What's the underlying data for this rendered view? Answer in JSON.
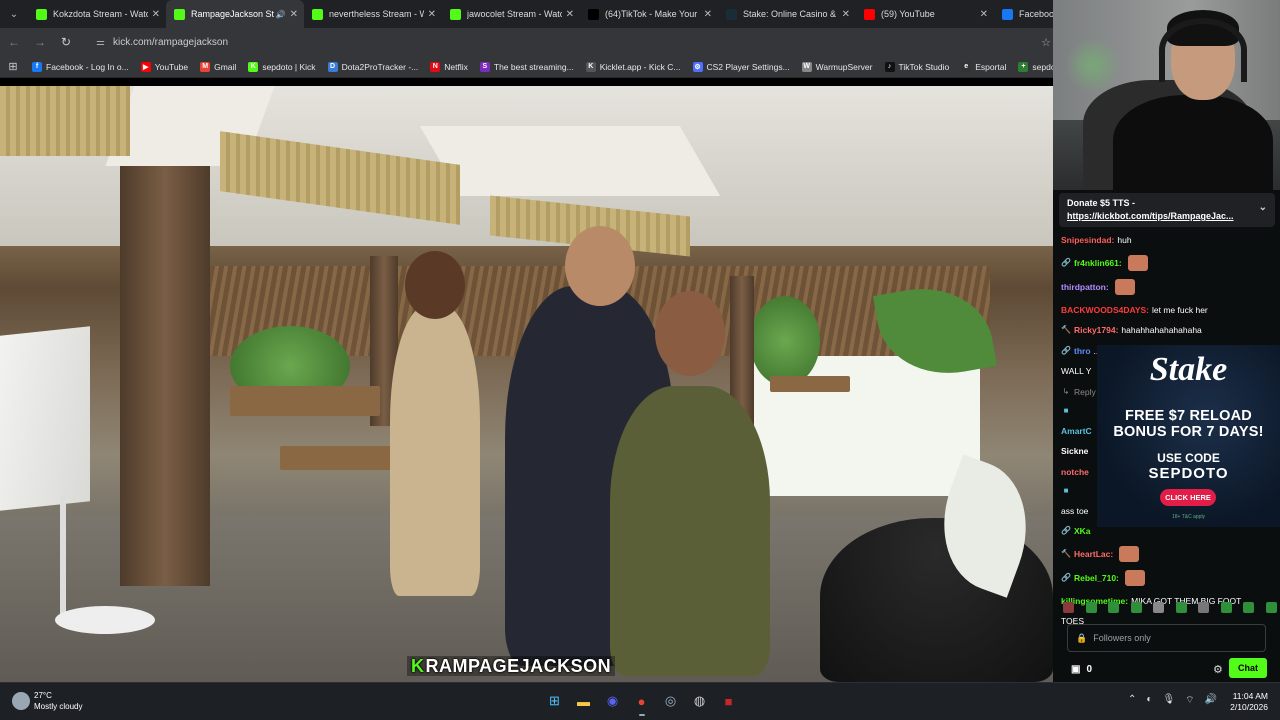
{
  "browser": {
    "tabs": [
      {
        "title": "Kokzdota Stream - Watch",
        "favicon": "kick",
        "color": "#53fc18",
        "active": false
      },
      {
        "title": "RampageJackson Stre",
        "favicon": "kick",
        "color": "#53fc18",
        "active": true
      },
      {
        "title": "nevertheless Stream - Wa",
        "favicon": "kick",
        "color": "#53fc18",
        "active": false
      },
      {
        "title": "jawocolet Stream - Watch",
        "favicon": "kick",
        "color": "#53fc18",
        "active": false
      },
      {
        "title": "(64)TikTok - Make Your D",
        "favicon": "tiktok",
        "color": "#000000",
        "active": false
      },
      {
        "title": "Stake: Online Casino & Sp",
        "favicon": "stake",
        "color": "#1a2c38",
        "active": false
      },
      {
        "title": "(59) YouTube",
        "favicon": "youtube",
        "color": "#ff0000",
        "active": false
      },
      {
        "title": "Facebook",
        "favicon": "facebook",
        "color": "#1877f2",
        "active": false
      }
    ],
    "url": "kick.com/rampagejackson",
    "bookmarks": [
      {
        "label": "Facebook - Log In o...",
        "color": "#1877f2",
        "glyph": "f"
      },
      {
        "label": "YouTube",
        "color": "#ff0000",
        "glyph": "▶"
      },
      {
        "label": "Gmail",
        "color": "#ea4335",
        "glyph": "M"
      },
      {
        "label": "sepdoto | Kick",
        "color": "#53fc18",
        "glyph": "K"
      },
      {
        "label": "Dota2ProTracker -...",
        "color": "#3a7bd5",
        "glyph": "D"
      },
      {
        "label": "Netflix",
        "color": "#e50914",
        "glyph": "N"
      },
      {
        "label": "The best streaming...",
        "color": "#7b2cbf",
        "glyph": "S"
      },
      {
        "label": "Kicklet.app - Kick C...",
        "color": "#555555",
        "glyph": "K"
      },
      {
        "label": "CS2 Player Settings...",
        "color": "#4c6fff",
        "glyph": "⚙"
      },
      {
        "label": "WarmupServer",
        "color": "#888888",
        "glyph": "W"
      },
      {
        "label": "TikTok Studio",
        "color": "#111111",
        "glyph": "♪"
      },
      {
        "label": "Esportal",
        "color": "#333333",
        "glyph": "e"
      },
      {
        "label": "sepdotes | Weig",
        "color": "#2e7d32",
        "glyph": "+"
      }
    ]
  },
  "stream": {
    "watermark_prefix": "K",
    "watermark_text": "RAMPAGEJACKSON"
  },
  "chat": {
    "pinned_title": "Donate $5 TTS -",
    "pinned_link": "https://kickbot.com/tips/RampageJac...",
    "messages": [
      {
        "user": "Snipesindad:",
        "color": "#ff5c5c",
        "text": "huh",
        "badge": "",
        "emote": false
      },
      {
        "user": "fr4nklin661:",
        "color": "#53fc18",
        "text": "",
        "badge": "🔗",
        "emote": true
      },
      {
        "user": "thirdpatton:",
        "color": "#b48cff",
        "text": "",
        "badge": "",
        "emote": true
      },
      {
        "user": "BACKWOODS4DAYS:",
        "color": "#ff3b3b",
        "text": "let me fuck her",
        "badge": "",
        "emote": false
      },
      {
        "user": "Ricky1794:",
        "color": "#ff6a6a",
        "text": "hahahhahahahahaha",
        "badge": "🔨",
        "emote": false
      },
      {
        "user": "thro",
        "color": "#5b8cff",
        "text": "... PUT YOUR HANDS THE",
        "badge": "🔗",
        "emote": false
      },
      {
        "user": "",
        "color": "#ffffff",
        "text": "WALL Y",
        "badge": "",
        "emote": false
      },
      {
        "user": "",
        "color": "#888888",
        "text": "Reply",
        "badge": "↳",
        "emote": false
      },
      {
        "user": "",
        "color": "#5bc0de",
        "text": "",
        "badge": "■",
        "emote": false
      },
      {
        "user": "AmartC",
        "color": "#5bc0de",
        "text": "",
        "badge": "",
        "emote": false
      },
      {
        "user": "Sickne",
        "color": "#ffffff",
        "text": "",
        "badge": "",
        "emote": false
      },
      {
        "user": "notche",
        "color": "#ff6a6a",
        "text": "",
        "badge": "",
        "emote": false
      },
      {
        "user": "",
        "color": "#5bc0de",
        "text": "",
        "badge": "■",
        "emote": false
      },
      {
        "user": "",
        "color": "#ffffff",
        "text": "ass toe",
        "badge": "",
        "emote": false
      },
      {
        "user": "XKa",
        "color": "#53fc18",
        "text": "",
        "badge": "🔗",
        "emote": false
      },
      {
        "user": "HeartLac:",
        "color": "#ff6a6a",
        "text": "",
        "badge": "🔨",
        "emote": true
      },
      {
        "user": "Rebel_710:",
        "color": "#53fc18",
        "text": "",
        "badge": "🔗",
        "emote": true
      },
      {
        "user": "killingsometime:",
        "color": "#53fc18",
        "text": "MIKA GOT THEM BIG FOOT",
        "badge": "",
        "emote": false
      },
      {
        "user": "",
        "color": "#ffffff",
        "text": "TOES",
        "badge": "",
        "emote": false
      }
    ],
    "input_placeholder": "Followers only",
    "points": "0",
    "chat_button": "Chat"
  },
  "ad": {
    "brand": "Stake",
    "line1": "FREE $7 RELOAD",
    "line2": "BONUS FOR 7 DAYS!",
    "use_code": "USE CODE",
    "code": "SEPDOTO",
    "cta": "CLICK HERE",
    "fine": "18+ T&C apply"
  },
  "taskbar": {
    "temp": "27°C",
    "weather": "Mostly cloudy",
    "time": "11:04 AM",
    "date": "2/10/2026",
    "apps": [
      {
        "name": "windows-start-icon",
        "glyph": "⊞",
        "color": "#4cc2ff"
      },
      {
        "name": "file-explorer-icon",
        "glyph": "▬",
        "color": "#f7c948"
      },
      {
        "name": "discord-icon",
        "glyph": "◉",
        "color": "#5865f2"
      },
      {
        "name": "chrome-icon",
        "glyph": "●",
        "color": "#ea4335"
      },
      {
        "name": "steam-icon",
        "glyph": "◎",
        "color": "#9fb4c8"
      },
      {
        "name": "obs-icon",
        "glyph": "◍",
        "color": "#cccccc"
      },
      {
        "name": "app-red-icon",
        "glyph": "■",
        "color": "#c62828"
      }
    ]
  }
}
